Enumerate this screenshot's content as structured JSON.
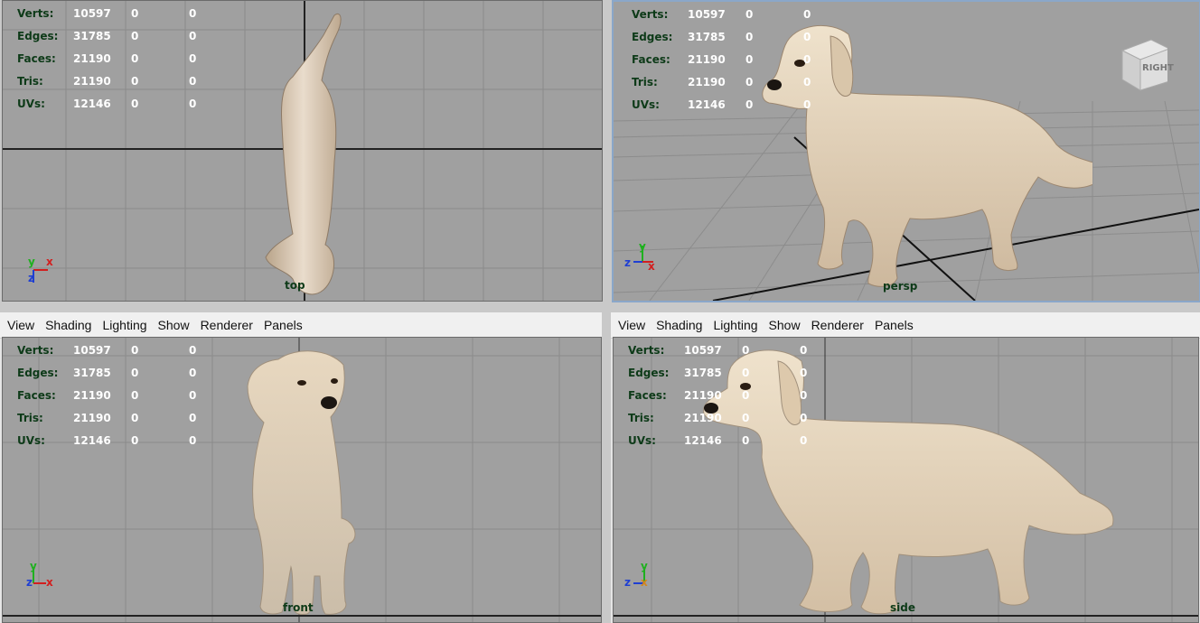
{
  "hud": {
    "labels": [
      "Verts:",
      "Edges:",
      "Faces:",
      "Tris:",
      "UVs:"
    ],
    "values": [
      [
        "10597",
        "0",
        "0"
      ],
      [
        "31785",
        "0",
        "0"
      ],
      [
        "21190",
        "0",
        "0"
      ],
      [
        "21190",
        "0",
        "0"
      ],
      [
        "12146",
        "0",
        "0"
      ]
    ]
  },
  "menu": {
    "view": "View",
    "shading": "Shading",
    "lighting": "Lighting",
    "show": "Show",
    "renderer": "Renderer",
    "panels": "Panels"
  },
  "viewports": {
    "top": {
      "camera": "top"
    },
    "persp": {
      "camera": "persp",
      "viewcube_label": "RIGHT"
    },
    "front": {
      "camera": "front"
    },
    "side": {
      "camera": "side"
    }
  },
  "axes": {
    "x": "x",
    "y": "y",
    "z": "z"
  },
  "colors": {
    "viewport_bg": "#a0a0a0",
    "hud_label": "#0d3a18",
    "hud_value": "#ffffff",
    "axis_x": "#d21f1f",
    "axis_y": "#1fb01f",
    "axis_z": "#1f3fd2"
  }
}
